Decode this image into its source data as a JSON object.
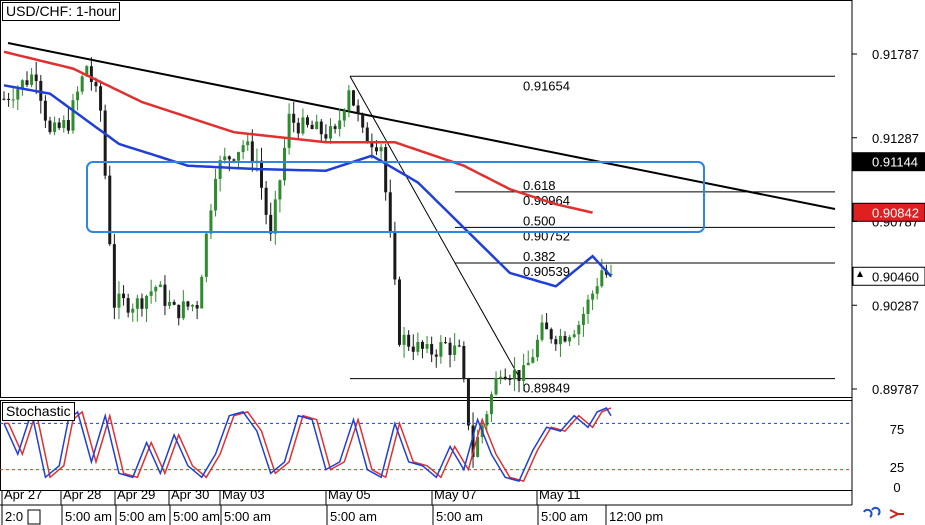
{
  "chart_title": "USD/CHF: 1-hour",
  "colors": {
    "up_candle": "#2e8b2e",
    "down_candle": "#1a1a1a",
    "ma_fast": "#1f3fd6",
    "ma_slow": "#e03030",
    "trendline": "#000000",
    "box": "#2e86de",
    "stoch_k": "#1f3fd6",
    "stoch_d": "#e03030",
    "level_upper": "#1f3fd6",
    "level_lower": "#e03030"
  },
  "chart_data": {
    "type": "candlestick",
    "title": "USD/CHF: 1-hour",
    "price_axis_ticks": [
      "0.91787",
      "0.91287",
      "0.90787",
      "0.90287",
      "0.89787"
    ],
    "price_markers": [
      {
        "label": "0.91144",
        "value": 0.91144,
        "bg": "#000000",
        "fg": "#ffffff"
      },
      {
        "label": "0.90842",
        "value": 0.90842,
        "bg": "#e02020",
        "fg": "#ffffff"
      },
      {
        "label": "0.90460",
        "value": 0.9046,
        "bg": "#ffffff",
        "fg": "#000000"
      }
    ],
    "date_labels": [
      "Apr 27",
      "Apr 28",
      "Apr 29",
      "Apr 30",
      "May 03",
      "May 05",
      "May 07",
      "May 11"
    ],
    "time_labels": [
      "2:0",
      "5:00 am",
      "5:00 am",
      "5:00 am",
      "5:00 am",
      "5:00 am",
      "5:00 am",
      "5:00 am",
      "12:00 pm"
    ],
    "fib_swing": {
      "high_label": "0.91654",
      "low_label": "0.89849",
      "high": 0.91654,
      "low": 0.89849
    },
    "fib_levels": [
      {
        "ratio_label": "0.618",
        "price_label": "0.90964",
        "ratio": 0.618,
        "price": 0.90964
      },
      {
        "ratio_label": "0.500",
        "price_label": "0.90752",
        "ratio": 0.5,
        "price": 0.90752
      },
      {
        "ratio_label": "0.382",
        "price_label": "0.90539",
        "ratio": 0.382,
        "price": 0.90539
      }
    ],
    "trendline_points": [
      {
        "index": 0,
        "price": 0.9185
      },
      {
        "index": 176,
        "price": 0.9085
      }
    ],
    "close_path": [
      {
        "i": 0,
        "p": 0.9152
      },
      {
        "i": 7,
        "p": 0.9168
      },
      {
        "i": 10,
        "p": 0.913
      },
      {
        "i": 14,
        "p": 0.9138
      },
      {
        "i": 18,
        "p": 0.9172
      },
      {
        "i": 21,
        "p": 0.9145
      },
      {
        "i": 24,
        "p": 0.903
      },
      {
        "i": 29,
        "p": 0.903
      },
      {
        "i": 33,
        "p": 0.904
      },
      {
        "i": 37,
        "p": 0.9025
      },
      {
        "i": 42,
        "p": 0.903
      },
      {
        "i": 46,
        "p": 0.911
      },
      {
        "i": 52,
        "p": 0.9125
      },
      {
        "i": 55,
        "p": 0.9115
      },
      {
        "i": 58,
        "p": 0.9068
      },
      {
        "i": 62,
        "p": 0.914
      },
      {
        "i": 65,
        "p": 0.9135
      },
      {
        "i": 72,
        "p": 0.913
      },
      {
        "i": 75,
        "p": 0.916
      },
      {
        "i": 78,
        "p": 0.913
      },
      {
        "i": 82,
        "p": 0.9125
      },
      {
        "i": 86,
        "p": 0.901
      },
      {
        "i": 92,
        "p": 0.9
      },
      {
        "i": 96,
        "p": 0.9005
      },
      {
        "i": 99,
        "p": 0.9
      },
      {
        "i": 102,
        "p": 0.894
      },
      {
        "i": 108,
        "p": 0.8992
      },
      {
        "i": 111,
        "p": 0.8988
      },
      {
        "i": 113,
        "p": 0.8987
      },
      {
        "i": 117,
        "p": 0.9013
      },
      {
        "i": 121,
        "p": 0.901
      },
      {
        "i": 125,
        "p": 0.9018
      },
      {
        "i": 128,
        "p": 0.9036
      },
      {
        "i": 130,
        "p": 0.905
      },
      {
        "i": 132,
        "p": 0.9044
      }
    ],
    "ma_fast": [
      {
        "i": 0,
        "p": 0.916
      },
      {
        "i": 10,
        "p": 0.9155
      },
      {
        "i": 25,
        "p": 0.9125
      },
      {
        "i": 40,
        "p": 0.9112
      },
      {
        "i": 55,
        "p": 0.911
      },
      {
        "i": 70,
        "p": 0.9109
      },
      {
        "i": 80,
        "p": 0.9118
      },
      {
        "i": 90,
        "p": 0.9102
      },
      {
        "i": 100,
        "p": 0.9075
      },
      {
        "i": 110,
        "p": 0.9048
      },
      {
        "i": 120,
        "p": 0.904
      },
      {
        "i": 128,
        "p": 0.9058
      },
      {
        "i": 132,
        "p": 0.9046
      }
    ],
    "ma_slow": [
      {
        "i": 0,
        "p": 0.918
      },
      {
        "i": 15,
        "p": 0.917
      },
      {
        "i": 30,
        "p": 0.915
      },
      {
        "i": 50,
        "p": 0.9132
      },
      {
        "i": 70,
        "p": 0.9126
      },
      {
        "i": 85,
        "p": 0.9126
      },
      {
        "i": 100,
        "p": 0.9112
      },
      {
        "i": 110,
        "p": 0.9098
      },
      {
        "i": 120,
        "p": 0.9089
      },
      {
        "i": 128,
        "p": 0.9084
      }
    ],
    "candle_count": 133,
    "stochastic": {
      "label": "Stochastic",
      "levels": [
        "75",
        "25",
        "0"
      ],
      "upper_level": 80,
      "lower_level": 20,
      "k_path": [
        {
          "i": 0,
          "v": 80
        },
        {
          "i": 3,
          "v": 40
        },
        {
          "i": 6,
          "v": 95
        },
        {
          "i": 9,
          "v": 10
        },
        {
          "i": 12,
          "v": 25
        },
        {
          "i": 14,
          "v": 85
        },
        {
          "i": 16,
          "v": 95
        },
        {
          "i": 19,
          "v": 30
        },
        {
          "i": 22,
          "v": 90
        },
        {
          "i": 25,
          "v": 15
        },
        {
          "i": 28,
          "v": 10
        },
        {
          "i": 31,
          "v": 55
        },
        {
          "i": 34,
          "v": 15
        },
        {
          "i": 37,
          "v": 65
        },
        {
          "i": 40,
          "v": 25
        },
        {
          "i": 43,
          "v": 10
        },
        {
          "i": 46,
          "v": 40
        },
        {
          "i": 49,
          "v": 90
        },
        {
          "i": 52,
          "v": 95
        },
        {
          "i": 55,
          "v": 70
        },
        {
          "i": 58,
          "v": 15
        },
        {
          "i": 61,
          "v": 30
        },
        {
          "i": 64,
          "v": 90
        },
        {
          "i": 67,
          "v": 85
        },
        {
          "i": 70,
          "v": 20
        },
        {
          "i": 73,
          "v": 30
        },
        {
          "i": 76,
          "v": 85
        },
        {
          "i": 79,
          "v": 20
        },
        {
          "i": 82,
          "v": 10
        },
        {
          "i": 85,
          "v": 80
        },
        {
          "i": 88,
          "v": 30
        },
        {
          "i": 91,
          "v": 25
        },
        {
          "i": 94,
          "v": 10
        },
        {
          "i": 97,
          "v": 50
        },
        {
          "i": 100,
          "v": 20
        },
        {
          "i": 103,
          "v": 85
        },
        {
          "i": 106,
          "v": 40
        },
        {
          "i": 109,
          "v": 10
        },
        {
          "i": 112,
          "v": 5
        },
        {
          "i": 115,
          "v": 45
        },
        {
          "i": 118,
          "v": 75
        },
        {
          "i": 121,
          "v": 70
        },
        {
          "i": 124,
          "v": 90
        },
        {
          "i": 127,
          "v": 75
        },
        {
          "i": 129,
          "v": 95
        },
        {
          "i": 131,
          "v": 100
        },
        {
          "i": 132,
          "v": 90
        }
      ]
    }
  }
}
